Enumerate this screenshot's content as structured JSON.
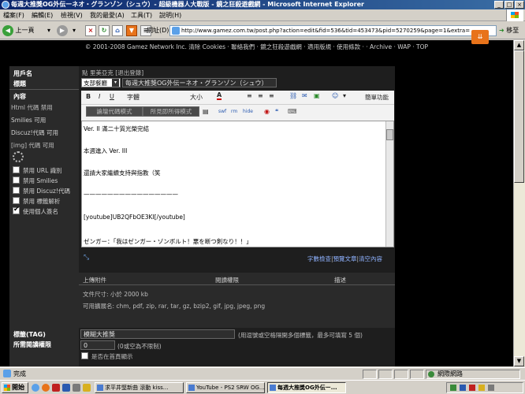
{
  "window": {
    "title": "每週大推獎OG外伝ーネオ・グランゾン（シュウ）- 超級機器人大戰版 - 鏡之狂殺遊戲網 - Microsoft Internet Explorer"
  },
  "menubar": {
    "items": [
      "檔案(F)",
      "編輯(E)",
      "檢視(V)",
      "我的最愛(A)",
      "工具(T)",
      "說明(H)"
    ]
  },
  "toolbar": {
    "back_label": "上一頁",
    "address_label": "網址(D)",
    "url": "http://www.gamez.com.tw/post.php?action=edit&fid=536&tid=453473&pid=5270259&page=1&extra=",
    "go_label": "移至",
    "links_label": "連結"
  },
  "page": {
    "copyright": "© 2001-2008 Gamez Network Inc. 清除 Cookies · 聯絡我們 · 鏡之狂殺遊戲網 · 適用版規 · 使用條款 · · Archive · WAP · TOP",
    "left": {
      "username_label": "用戶名",
      "title_label": "標題",
      "content_label": "內容",
      "html_status": "Html 代碼 禁用",
      "smilies_status": "Smilies 可用",
      "discuz_status": "Discuz!代碼 可用",
      "img_status": "[img] 代碼 可用",
      "options": [
        {
          "label": "禁用 URL 識別",
          "checked": false
        },
        {
          "label": "禁用 Smilies",
          "checked": false
        },
        {
          "label": "禁用 Discuz!代碼",
          "checked": false
        },
        {
          "label": "禁用 標籤解析",
          "checked": false
        },
        {
          "label": "使用個人簽名",
          "checked": true
        }
      ],
      "tags_label": "標籤(TAG)",
      "read_perm_label": "所需閱讀權限"
    },
    "main": {
      "user_line": "點 里美亞克 [退出登錄]",
      "category_value": "支部餐廳",
      "subject_value": "每週大推獎OG外伝ーネオ・グランゾン（シュウ）",
      "font_select": "字體",
      "size_select": "大小",
      "simple_mode": "簡單功能",
      "tab_code": "論壇代碼模式",
      "tab_wysiwyg": "所見即所得模式",
      "lines": [
        "Ver. II 滿二十質光榮完結",
        "",
        "本週進入 Ver. III",
        "",
        "還請大家繼續支持與指教（笑",
        "",
        "————————————————",
        "",
        "[youtube]UB2QFbOE3KI[/youtube]",
        "",
        "ゼンガー：「我はゼンガー・ゾンボルト！悪を断つ剣なり！！」"
      ],
      "check_length": "字數檢查",
      "preview": "預覽文章",
      "clear": "清空內容",
      "attach_header": "上傳附件",
      "attach_perm_header": "閱讀權限",
      "attach_desc_header": "描述",
      "filesize_line": "文件尺寸: 小於 2000 kb",
      "ext_line": "可用擴展名: chm, pdf, zip, rar, tar, gz, bzip2, gif, jpg, jpeg, png",
      "tag_value": "模糊大推獎",
      "tag_hint": "(用逗號或空格隔開多個標籤，最多可填寫 5 個)",
      "read_perm_value": "0",
      "read_perm_hint": "(0或空為不限制)",
      "homepage_check": "是否在首頁顯示"
    }
  },
  "statusbar": {
    "status": "完成",
    "zone": "網際網路"
  },
  "taskbar": {
    "start": "開始",
    "tasks": [
      "求平井堅新曲 滾動 kiss...",
      "YouTube - PS2 SRW OG...",
      "每週大推獎OG外伝ー..."
    ],
    "tray_text": ""
  },
  "colors": {
    "title_bar": "#0a246a",
    "page_background": "#000000",
    "panel_dark": "#2a2a2a",
    "link_blue": "#8fb2ff",
    "download_button": "#e8731a"
  }
}
